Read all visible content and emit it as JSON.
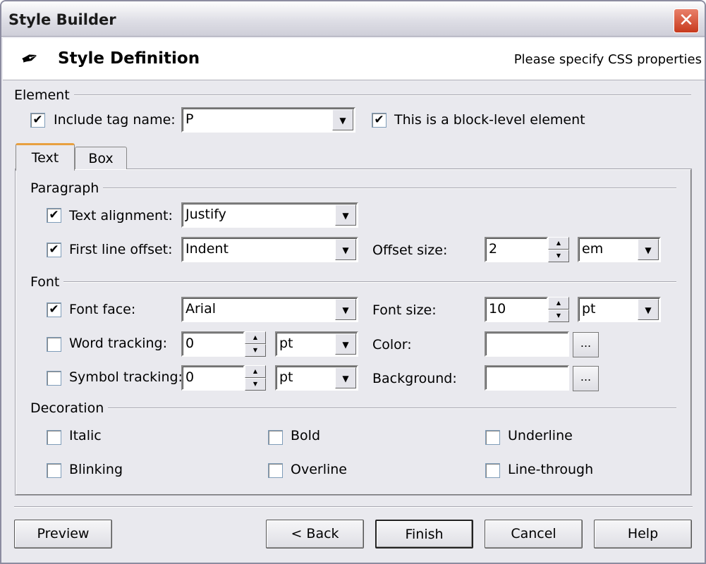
{
  "window": {
    "title": "Style Builder",
    "close": "✕"
  },
  "header": {
    "icon": "quill-pen-icon",
    "title": "Style Definition",
    "subtitle": "Please specify CSS properties"
  },
  "element": {
    "group": "Element",
    "include_tag_label": "Include tag name:",
    "include_tag_checked": true,
    "tag_value": "P",
    "block_label": "This is a block-level element",
    "block_checked": true
  },
  "tabs": [
    {
      "label": "Text",
      "active": true
    },
    {
      "label": "Box",
      "active": false
    }
  ],
  "paragraph": {
    "group": "Paragraph",
    "text_alignment": {
      "label": "Text alignment:",
      "checked": true,
      "value": "Justify"
    },
    "first_line_offset": {
      "label": "First line offset:",
      "checked": true,
      "value": "Indent"
    },
    "offset_size": {
      "label": "Offset size:",
      "value": "2",
      "unit": "em"
    }
  },
  "font": {
    "group": "Font",
    "font_face": {
      "label": "Font face:",
      "checked": true,
      "value": "Arial"
    },
    "font_size": {
      "label": "Font size:",
      "value": "10",
      "unit": "pt"
    },
    "word_tracking": {
      "label": "Word tracking:",
      "checked": false,
      "value": "0",
      "unit": "pt"
    },
    "symbol_tracking": {
      "label": "Symbol tracking:",
      "checked": false,
      "value": "0",
      "unit": "pt"
    },
    "color": {
      "label": "Color:",
      "value": "",
      "button": "..."
    },
    "background": {
      "label": "Background:",
      "value": "",
      "button": "..."
    }
  },
  "decoration": {
    "group": "Decoration",
    "items": [
      {
        "label": "Italic",
        "checked": false
      },
      {
        "label": "Bold",
        "checked": false
      },
      {
        "label": "Underline",
        "checked": false
      },
      {
        "label": "Blinking",
        "checked": false
      },
      {
        "label": "Overline",
        "checked": false
      },
      {
        "label": "Line-through",
        "checked": false
      }
    ]
  },
  "buttons": {
    "preview": "Preview",
    "back": "< Back",
    "finish": "Finish",
    "cancel": "Cancel",
    "help": "Help"
  },
  "check_mark": "✔"
}
